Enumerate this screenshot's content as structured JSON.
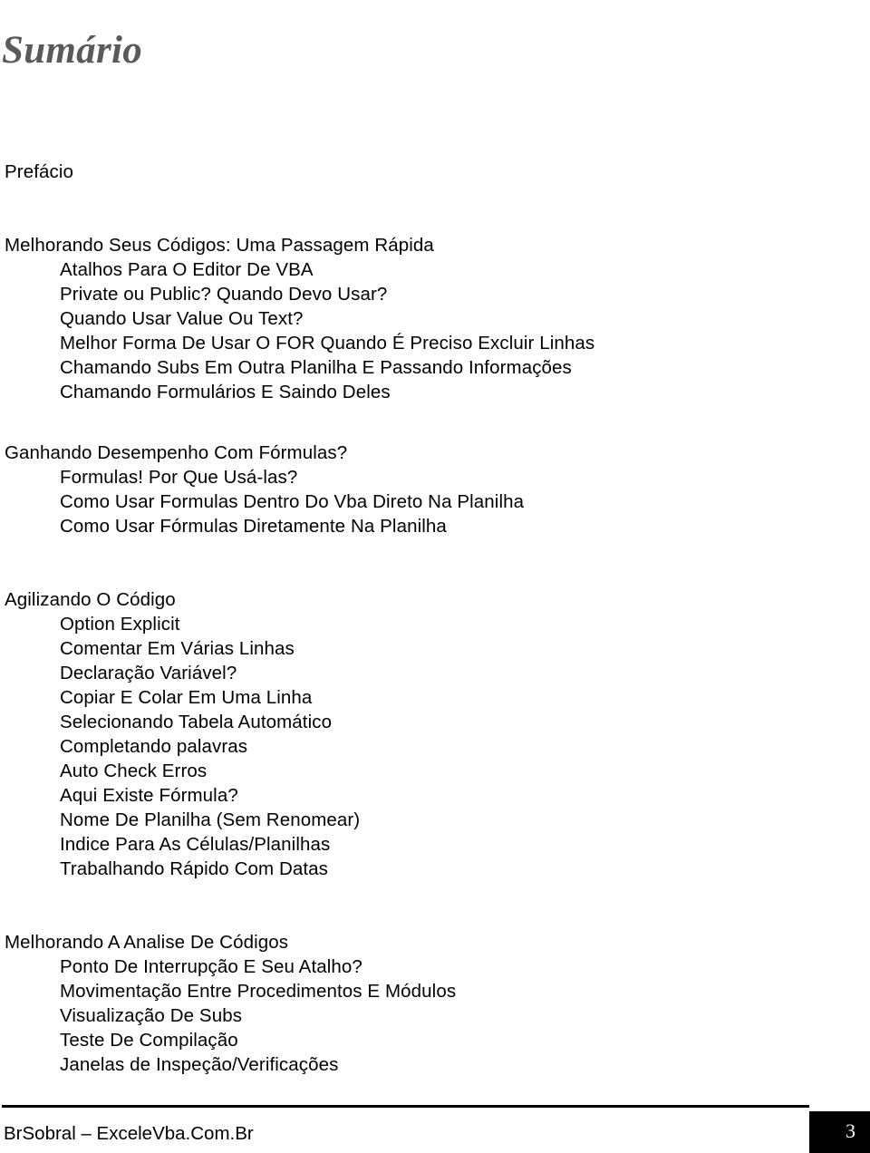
{
  "document": {
    "title": "Sumário",
    "title_color": "#5a5a5a",
    "text_color": "#000000",
    "background": "#ffffff"
  },
  "toc": {
    "entries": [
      {
        "label": "Prefácio",
        "level": 0
      },
      {
        "label": "Melhorando Seus Códigos: Uma Passagem Rápida",
        "level": 0
      },
      {
        "label": "Atalhos Para O Editor De VBA",
        "level": 1
      },
      {
        "label": "Private ou Public? Quando Devo Usar?",
        "level": 1
      },
      {
        "label": "Quando Usar Value Ou Text?",
        "level": 1
      },
      {
        "label": "Melhor Forma De Usar O FOR Quando É Preciso Excluir Linhas",
        "level": 1
      },
      {
        "label": "Chamando Subs Em Outra Planilha E Passando Informações",
        "level": 1
      },
      {
        "label": "Chamando Formulários E Saindo Deles",
        "level": 1
      },
      {
        "label": "Ganhando Desempenho Com Fórmulas?",
        "level": 0
      },
      {
        "label": "Formulas! Por Que Usá-las?",
        "level": 1
      },
      {
        "label": "Como Usar Formulas Dentro Do Vba Direto Na Planilha",
        "level": 1
      },
      {
        "label": "Como Usar Fórmulas Diretamente Na Planilha",
        "level": 1
      },
      {
        "label": "Agilizando O Código",
        "level": 0
      },
      {
        "label": "Option Explicit",
        "level": 1
      },
      {
        "label": "Comentar Em Várias Linhas",
        "level": 1
      },
      {
        "label": "Declaração Variável?",
        "level": 1
      },
      {
        "label": "Copiar E Colar Em Uma Linha",
        "level": 1
      },
      {
        "label": "Selecionando Tabela Automático",
        "level": 1
      },
      {
        "label": "Completando palavras",
        "level": 1
      },
      {
        "label": "Auto Check Erros",
        "level": 1
      },
      {
        "label": "Aqui Existe Fórmula?",
        "level": 1
      },
      {
        "label": "Nome De Planilha (Sem Renomear)",
        "level": 1
      },
      {
        "label": "Indice Para As Células/Planilhas",
        "level": 1
      },
      {
        "label": "Trabalhando Rápido Com Datas",
        "level": 1
      },
      {
        "label": "Melhorando A Analise De Códigos",
        "level": 0
      },
      {
        "label": "Ponto De Interrupção E Seu Atalho?",
        "level": 1
      },
      {
        "label": "Movimentação Entre Procedimentos E Módulos",
        "level": 1
      },
      {
        "label": "Visualização De Subs",
        "level": 1
      },
      {
        "label": "Teste De Compilação",
        "level": 1
      },
      {
        "label": "Janelas de Inspeção/Verificações",
        "level": 1
      }
    ]
  },
  "footer": {
    "text": "BrSobral – ExceleVba.Com.Br",
    "page_number": "3",
    "page_number_box_color": "#000000",
    "page_number_text_color": "#ffffff"
  }
}
